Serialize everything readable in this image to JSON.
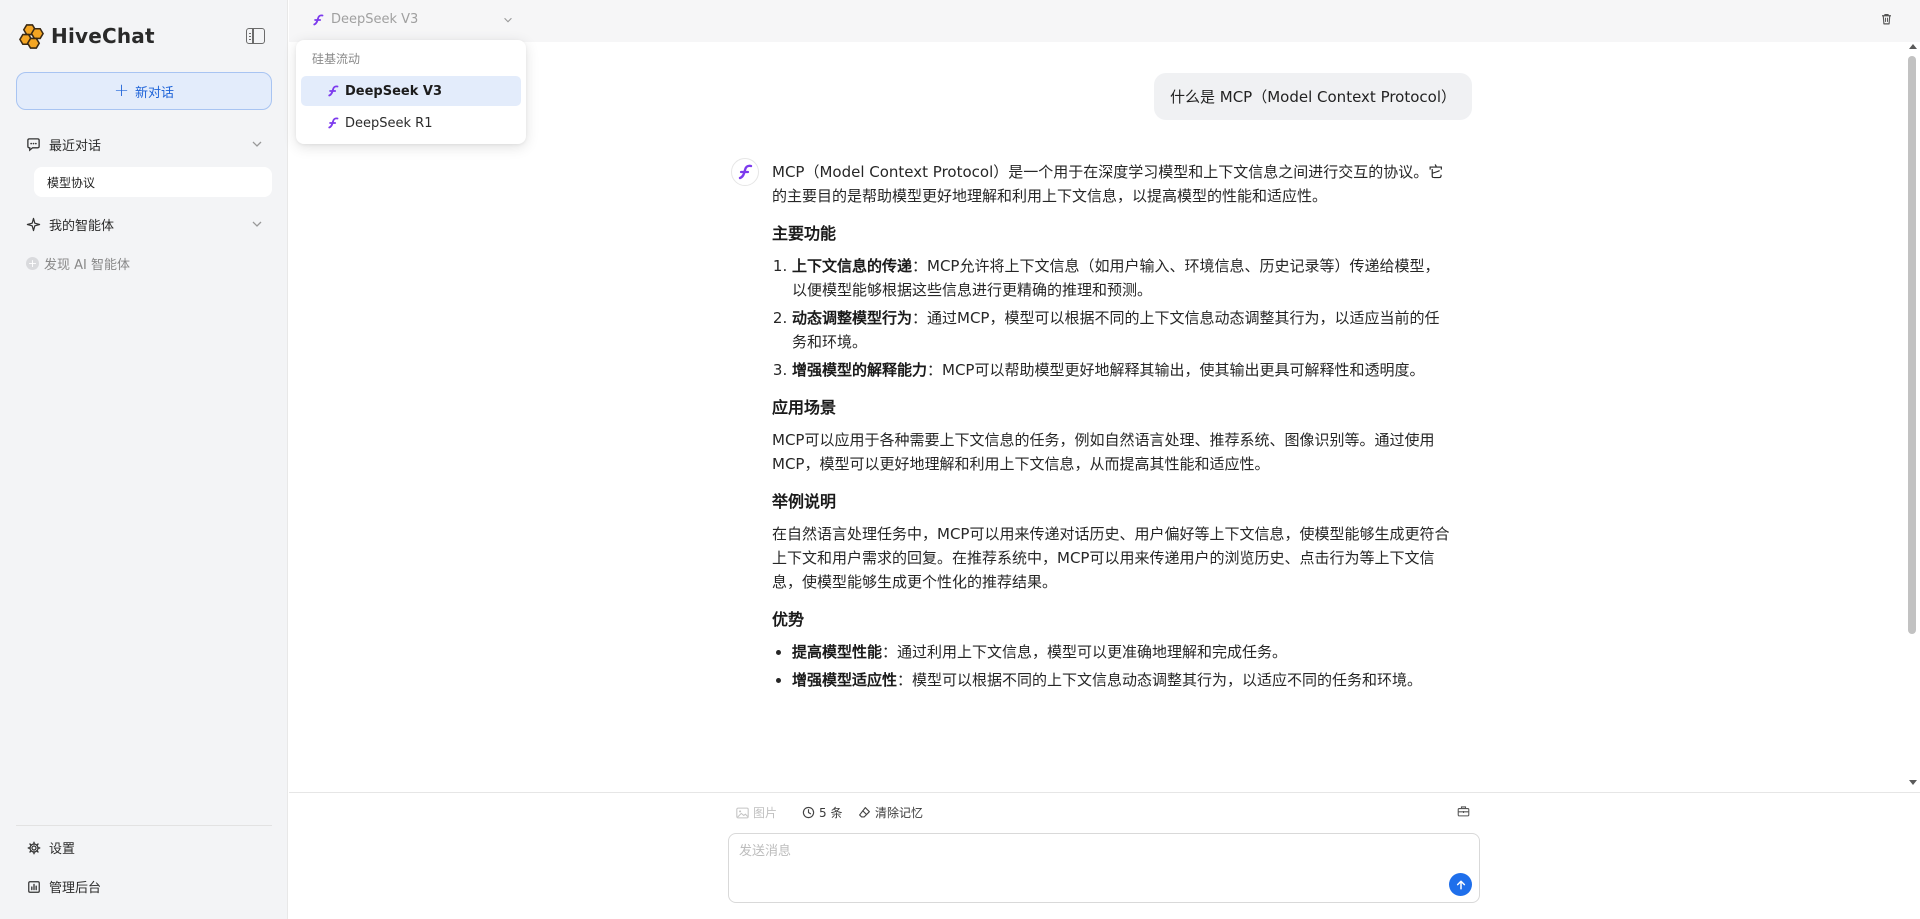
{
  "app": {
    "name": "HiveChat"
  },
  "sidebar": {
    "new_chat_label": "新对话",
    "recent_label": "最近对话",
    "recent_items": [
      {
        "label": "模型协议"
      }
    ],
    "agents_label": "我的智能体",
    "discover_label": "发现 AI 智能体",
    "settings_label": "设置",
    "admin_label": "管理后台"
  },
  "header": {
    "model_selected": "DeepSeek V3"
  },
  "model_dropdown": {
    "group_label": "硅基流动",
    "options": [
      {
        "label": "DeepSeek V3",
        "selected": true
      },
      {
        "label": "DeepSeek R1",
        "selected": false
      }
    ]
  },
  "conversation": {
    "user_message": "什么是 MCP（Model Context Protocol）",
    "assistant": {
      "intro": "MCP（Model Context Protocol）是一个用于在深度学习模型和上下文信息之间进行交互的协议。它的主要目的是帮助模型更好地理解和利用上下文信息，以提高模型的性能和适应性。",
      "h_features": "主要功能",
      "features": [
        {
          "title": "上下文信息的传递",
          "text": "：MCP允许将上下文信息（如用户输入、环境信息、历史记录等）传递给模型，以便模型能够根据这些信息进行更精确的推理和预测。"
        },
        {
          "title": "动态调整模型行为",
          "text": "：通过MCP，模型可以根据不同的上下文信息动态调整其行为，以适应当前的任务和环境。"
        },
        {
          "title": "增强模型的解释能力",
          "text": "：MCP可以帮助模型更好地解释其输出，使其输出更具可解释性和透明度。"
        }
      ],
      "h_scenarios": "应用场景",
      "scenarios": "MCP可以应用于各种需要上下文信息的任务，例如自然语言处理、推荐系统、图像识别等。通过使用MCP，模型可以更好地理解和利用上下文信息，从而提高其性能和适应性。",
      "h_example": "举例说明",
      "example": "在自然语言处理任务中，MCP可以用来传递对话历史、用户偏好等上下文信息，使模型能够生成更符合上下文和用户需求的回复。在推荐系统中，MCP可以用来传递用户的浏览历史、点击行为等上下文信息，使模型能够生成更个性化的推荐结果。",
      "h_advantages": "优势",
      "advantages": [
        {
          "title": "提高模型性能",
          "text": "：通过利用上下文信息，模型可以更准确地理解和完成任务。"
        },
        {
          "title": "增强模型适应性",
          "text": "：模型可以根据不同的上下文信息动态调整其行为，以适应不同的任务和环境。"
        }
      ]
    }
  },
  "input_toolbar": {
    "image_label": "图片",
    "history_label": "5 条",
    "clear_memory_label": "清除记忆"
  },
  "input": {
    "placeholder": "发送消息"
  },
  "colors": {
    "accent": "#1f6feb",
    "model_icon": "#7c3aed",
    "selected_bg": "#e3ecfb"
  },
  "icons": [
    "hive-logo-icon",
    "sidebar-toggle-icon",
    "plus-icon",
    "chat-bubble-icon",
    "chevron-down-icon",
    "sparkle-icon",
    "plus-circle-icon",
    "gear-icon",
    "dashboard-icon",
    "model-icon",
    "trash-icon",
    "image-icon",
    "clock-icon",
    "eraser-icon",
    "toolbox-icon",
    "arrow-up-icon"
  ]
}
